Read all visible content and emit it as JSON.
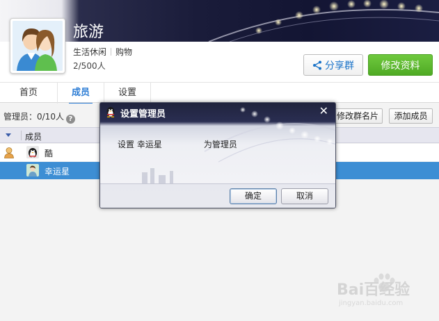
{
  "header": {
    "group_name": "旅游",
    "tags": [
      "生活休闲",
      "购物"
    ],
    "member_count": "2/500人",
    "share_button": "分享群",
    "edit_button": "修改资料"
  },
  "tabs": [
    {
      "label": "首页"
    },
    {
      "label": "成员",
      "active": true
    },
    {
      "label": "设置"
    }
  ],
  "toolbar": {
    "admin_label": "管理员：0/10人",
    "help_icon": "?",
    "rename_card_button": "修改群名片",
    "add_member_button": "添加成员"
  },
  "table": {
    "column_member": "成员",
    "rows": [
      {
        "name": "酷",
        "role": "owner",
        "selected": false
      },
      {
        "name": "幸运星",
        "role": "member",
        "selected": true
      }
    ]
  },
  "dialog": {
    "title": "设置管理员",
    "close_glyph": "✕",
    "message_prefix": "设置  幸运星",
    "message_suffix": "为管理员",
    "ok_button": "确定",
    "cancel_button": "取消"
  },
  "watermark": {
    "text": "Bai百经验",
    "url": "jingyan.baidu.com"
  },
  "colors": {
    "accent": "#2a7bd4",
    "edit_button": "#5cb82f",
    "selected_row": "#3d8ed4"
  }
}
